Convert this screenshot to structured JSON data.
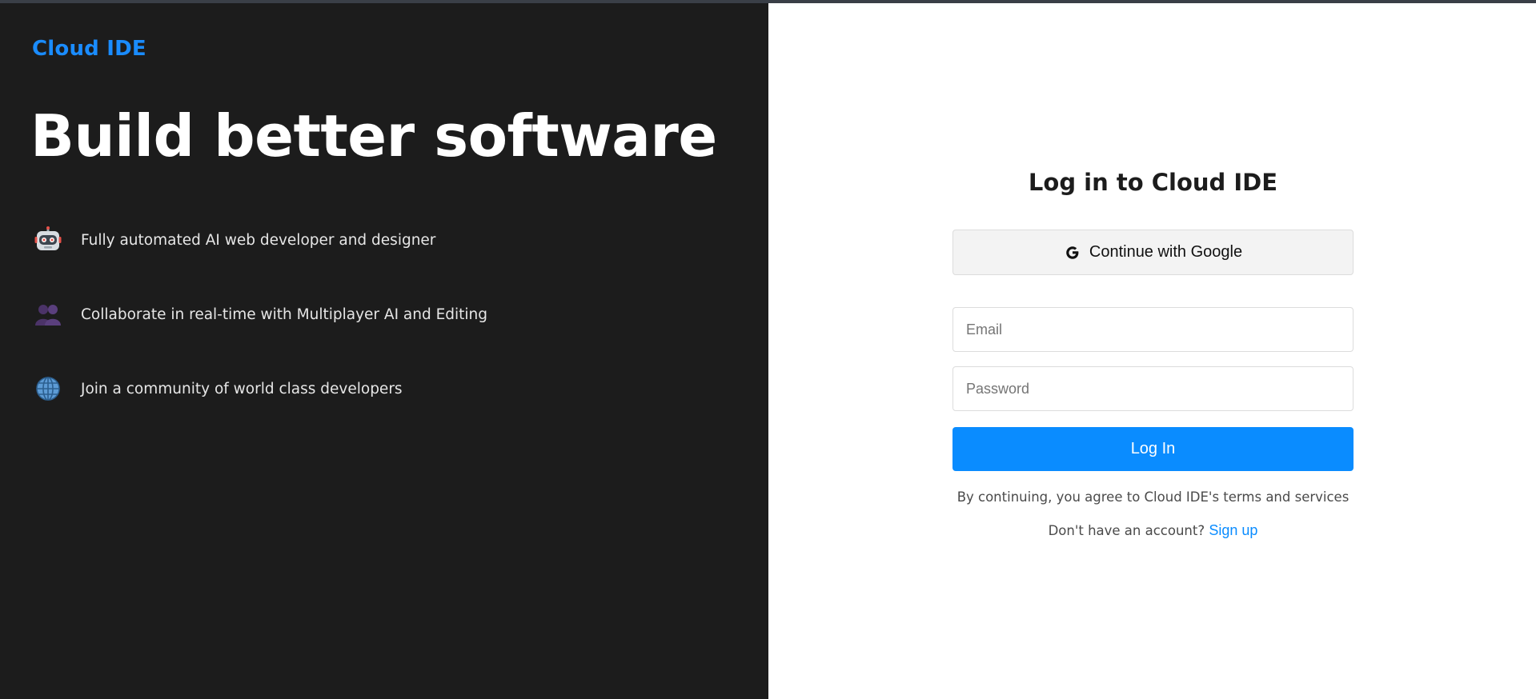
{
  "brand": {
    "name": "Cloud IDE",
    "color": "#1a8cff"
  },
  "hero": {
    "headline": "Build better software"
  },
  "features": [
    {
      "icon": "robot-icon",
      "text": "Fully automated AI web developer and designer"
    },
    {
      "icon": "people-icon",
      "text": "Collaborate in real-time with Multiplayer AI and Editing"
    },
    {
      "icon": "globe-icon",
      "text": "Join a community of world class developers"
    }
  ],
  "login": {
    "title": "Log in to Cloud IDE",
    "google_button": {
      "icon": "google-icon",
      "label": "Continue with Google"
    },
    "email": {
      "placeholder": "Email",
      "value": ""
    },
    "password": {
      "placeholder": "Password",
      "value": ""
    },
    "submit_label": "Log In",
    "terms_text": "By continuing, you agree to Cloud IDE's terms and services",
    "no_account_text": "Don't have an account?",
    "signup_label": "Sign up"
  },
  "colors": {
    "left_background": "#1c1c1c",
    "right_background": "#ffffff",
    "accent": "#0a8cff"
  }
}
